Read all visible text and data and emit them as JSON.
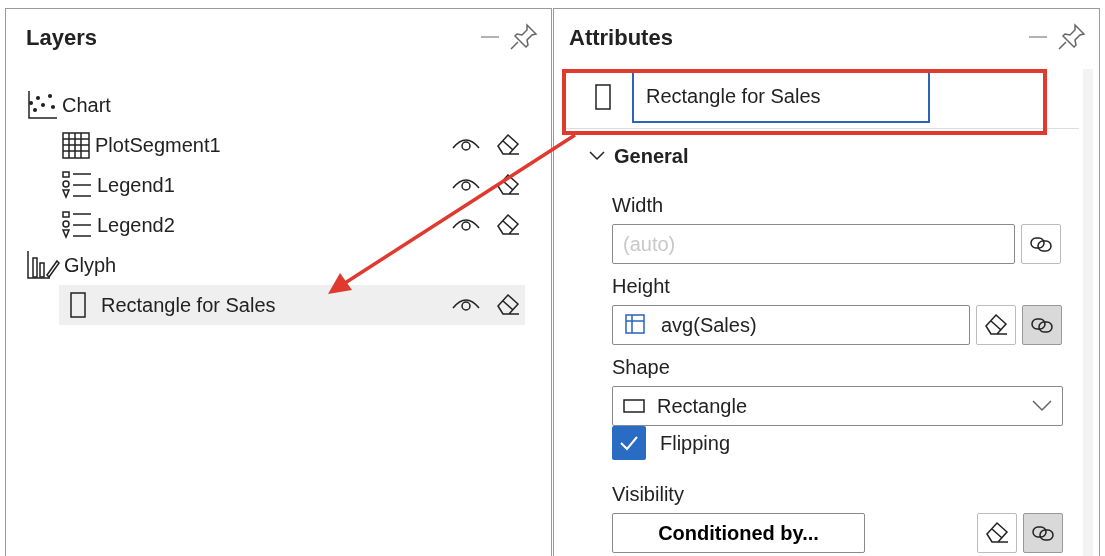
{
  "layers": {
    "title": "Layers",
    "tree": [
      {
        "kind": "chart",
        "label": "Chart",
        "selected": false,
        "children": [
          {
            "kind": "plot",
            "label": "PlotSegment1",
            "selected": false
          },
          {
            "kind": "legend",
            "label": "Legend1",
            "selected": false
          },
          {
            "kind": "legend",
            "label": "Legend2",
            "selected": false
          }
        ]
      },
      {
        "kind": "glyph",
        "label": "Glyph",
        "selected": false,
        "children": [
          {
            "kind": "rect",
            "label": "Rectangle for Sales",
            "selected": true
          }
        ]
      }
    ]
  },
  "attributes": {
    "title": "Attributes",
    "name_field": {
      "value": "Rectangle for Sales"
    },
    "section": {
      "label": "General",
      "expanded": true
    },
    "fields": [
      {
        "kind": "text",
        "label": "Width",
        "placeholder": "(auto)",
        "linked": false
      },
      {
        "kind": "expression",
        "label": "Height",
        "value": "avg(Sales)",
        "linked": true
      },
      {
        "kind": "select",
        "label": "Shape",
        "value": "Rectangle"
      },
      {
        "kind": "checkbox",
        "label": "Flipping",
        "checked": true
      },
      {
        "kind": "button",
        "label": "Visibility",
        "value": "Conditioned by...",
        "linked": true
      }
    ]
  }
}
